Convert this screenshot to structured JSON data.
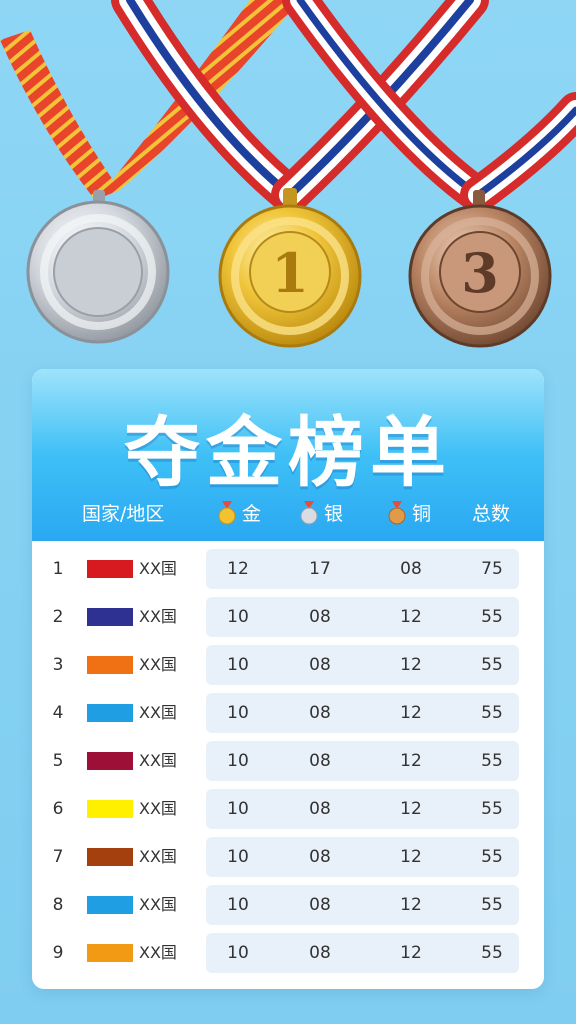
{
  "board": {
    "title": "夺金榜单",
    "headers": {
      "country": "国家/地区",
      "gold": "金",
      "silver": "银",
      "bronze": "铜",
      "total": "总数"
    }
  },
  "medals_photo": {
    "silver_label": "",
    "gold_label": "1",
    "bronze_label": "3"
  },
  "colors": {
    "accent": "#2aa8f2",
    "pill": "#e8f1fa",
    "gold": "#e8b820",
    "silver": "#c8ccd2",
    "bronze": "#b07a55"
  },
  "rows": [
    {
      "rank": "1",
      "name": "XX国",
      "flag": "#d71920",
      "gold": "12",
      "silver": "17",
      "bronze": "08",
      "total": "75"
    },
    {
      "rank": "2",
      "name": "XX国",
      "flag": "#2e3192",
      "gold": "10",
      "silver": "08",
      "bronze": "12",
      "total": "55"
    },
    {
      "rank": "3",
      "name": "XX国",
      "flag": "#f07014",
      "gold": "10",
      "silver": "08",
      "bronze": "12",
      "total": "55"
    },
    {
      "rank": "4",
      "name": "XX国",
      "flag": "#1f9ee3",
      "gold": "10",
      "silver": "08",
      "bronze": "12",
      "total": "55"
    },
    {
      "rank": "5",
      "name": "XX国",
      "flag": "#9e0f38",
      "gold": "10",
      "silver": "08",
      "bronze": "12",
      "total": "55"
    },
    {
      "rank": "6",
      "name": "XX国",
      "flag": "#fff000",
      "gold": "10",
      "silver": "08",
      "bronze": "12",
      "total": "55"
    },
    {
      "rank": "7",
      "name": "XX国",
      "flag": "#a4400e",
      "gold": "10",
      "silver": "08",
      "bronze": "12",
      "total": "55"
    },
    {
      "rank": "8",
      "name": "XX国",
      "flag": "#1f9ee3",
      "gold": "10",
      "silver": "08",
      "bronze": "12",
      "total": "55"
    },
    {
      "rank": "9",
      "name": "XX国",
      "flag": "#f39a14",
      "gold": "10",
      "silver": "08",
      "bronze": "12",
      "total": "55"
    }
  ]
}
